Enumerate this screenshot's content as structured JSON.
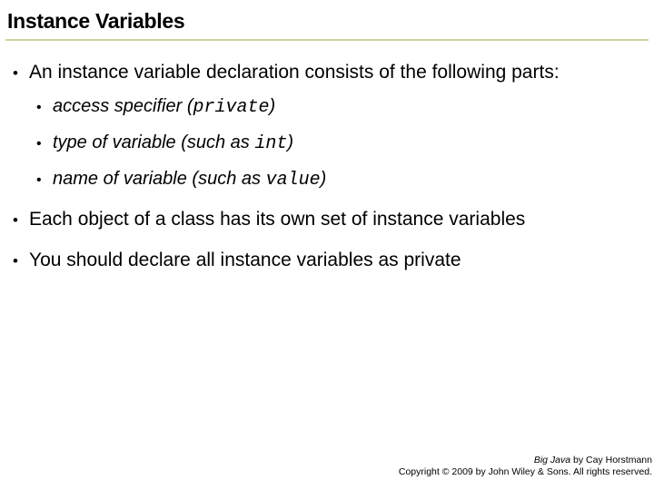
{
  "title": "Instance Variables",
  "bullets": {
    "p1": "An instance variable declaration consists of the following parts:",
    "s1a": "access specifier (",
    "s1b": "private",
    "s1c": ")",
    "s2a": "type of variable (such as ",
    "s2b": "int",
    "s2c": ")",
    "s3a": "name of variable (such as ",
    "s3b": "value",
    "s3c": ")",
    "p2": "Each object of a class has its own set of instance variables",
    "p3": "You should declare all instance variables as private"
  },
  "footer": {
    "book": "Big Java",
    "by": " by Cay Horstmann",
    "copyright": "Copyright © 2009 by John Wiley & Sons.  All rights reserved."
  },
  "glyphs": {
    "bullet": "•"
  }
}
